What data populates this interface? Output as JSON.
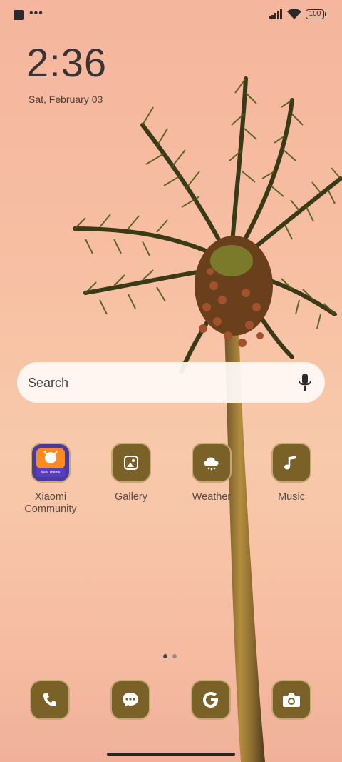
{
  "status_bar": {
    "dots": "•••",
    "battery": "100"
  },
  "clock": {
    "time": "2:36",
    "date": "Sat, February 03"
  },
  "search": {
    "placeholder": "Search"
  },
  "apps": [
    {
      "label": "Xiaomi\nCommunity",
      "icon": "xiaomi-community-icon",
      "badge": "New Theme"
    },
    {
      "label": "Gallery",
      "icon": "gallery-icon"
    },
    {
      "label": "Weather",
      "icon": "weather-icon"
    },
    {
      "label": "Music",
      "icon": "music-icon"
    }
  ],
  "dock": [
    {
      "icon": "phone-icon"
    },
    {
      "icon": "messages-icon"
    },
    {
      "icon": "google-icon"
    },
    {
      "icon": "camera-icon"
    }
  ],
  "pager": {
    "pages": 2,
    "active": 1
  },
  "colors": {
    "icon_bg": "#7a6127",
    "icon_border": "#c4a972",
    "sky": "#f6bca2"
  }
}
